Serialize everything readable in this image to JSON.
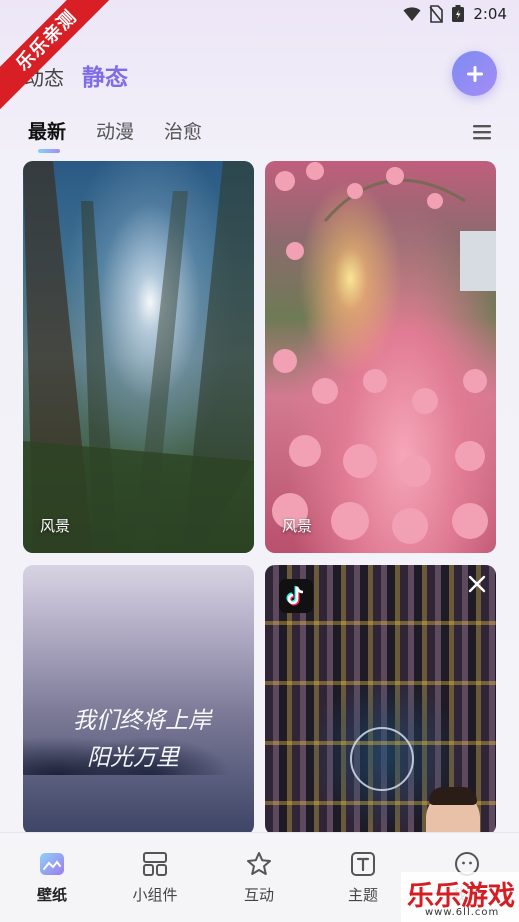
{
  "status_bar": {
    "time": "2:04"
  },
  "watermark": {
    "ribbon": "乐乐亲测",
    "brand": "乐乐游戏",
    "brand_url": "www.6ll.com"
  },
  "mode_tabs": [
    {
      "label": "动态",
      "active": false
    },
    {
      "label": "静态",
      "active": true
    }
  ],
  "category_tabs": [
    {
      "label": "最新",
      "active": true
    },
    {
      "label": "动漫",
      "active": false
    },
    {
      "label": "治愈",
      "active": false
    }
  ],
  "wallpapers": [
    {
      "label": "风景",
      "subject": "forest-sunbeams"
    },
    {
      "label": "风景",
      "subject": "rose-garden-sunset"
    },
    {
      "text_lines": [
        "我们终将上岸",
        "阳光万里"
      ],
      "subject": "misty-tower"
    },
    {
      "subject": "douyin-ad",
      "ad_icon": "tiktok-icon"
    }
  ],
  "bottom_nav": [
    {
      "label": "壁纸",
      "icon": "wallpaper-icon",
      "active": true
    },
    {
      "label": "小组件",
      "icon": "widget-icon",
      "active": false
    },
    {
      "label": "互动",
      "icon": "star-icon",
      "active": false
    },
    {
      "label": "主题",
      "icon": "theme-icon",
      "active": false
    },
    {
      "label": "我的",
      "icon": "profile-icon",
      "active": false
    }
  ],
  "colors": {
    "accent": "#7f6de8",
    "ribbon": "#d81f26"
  }
}
